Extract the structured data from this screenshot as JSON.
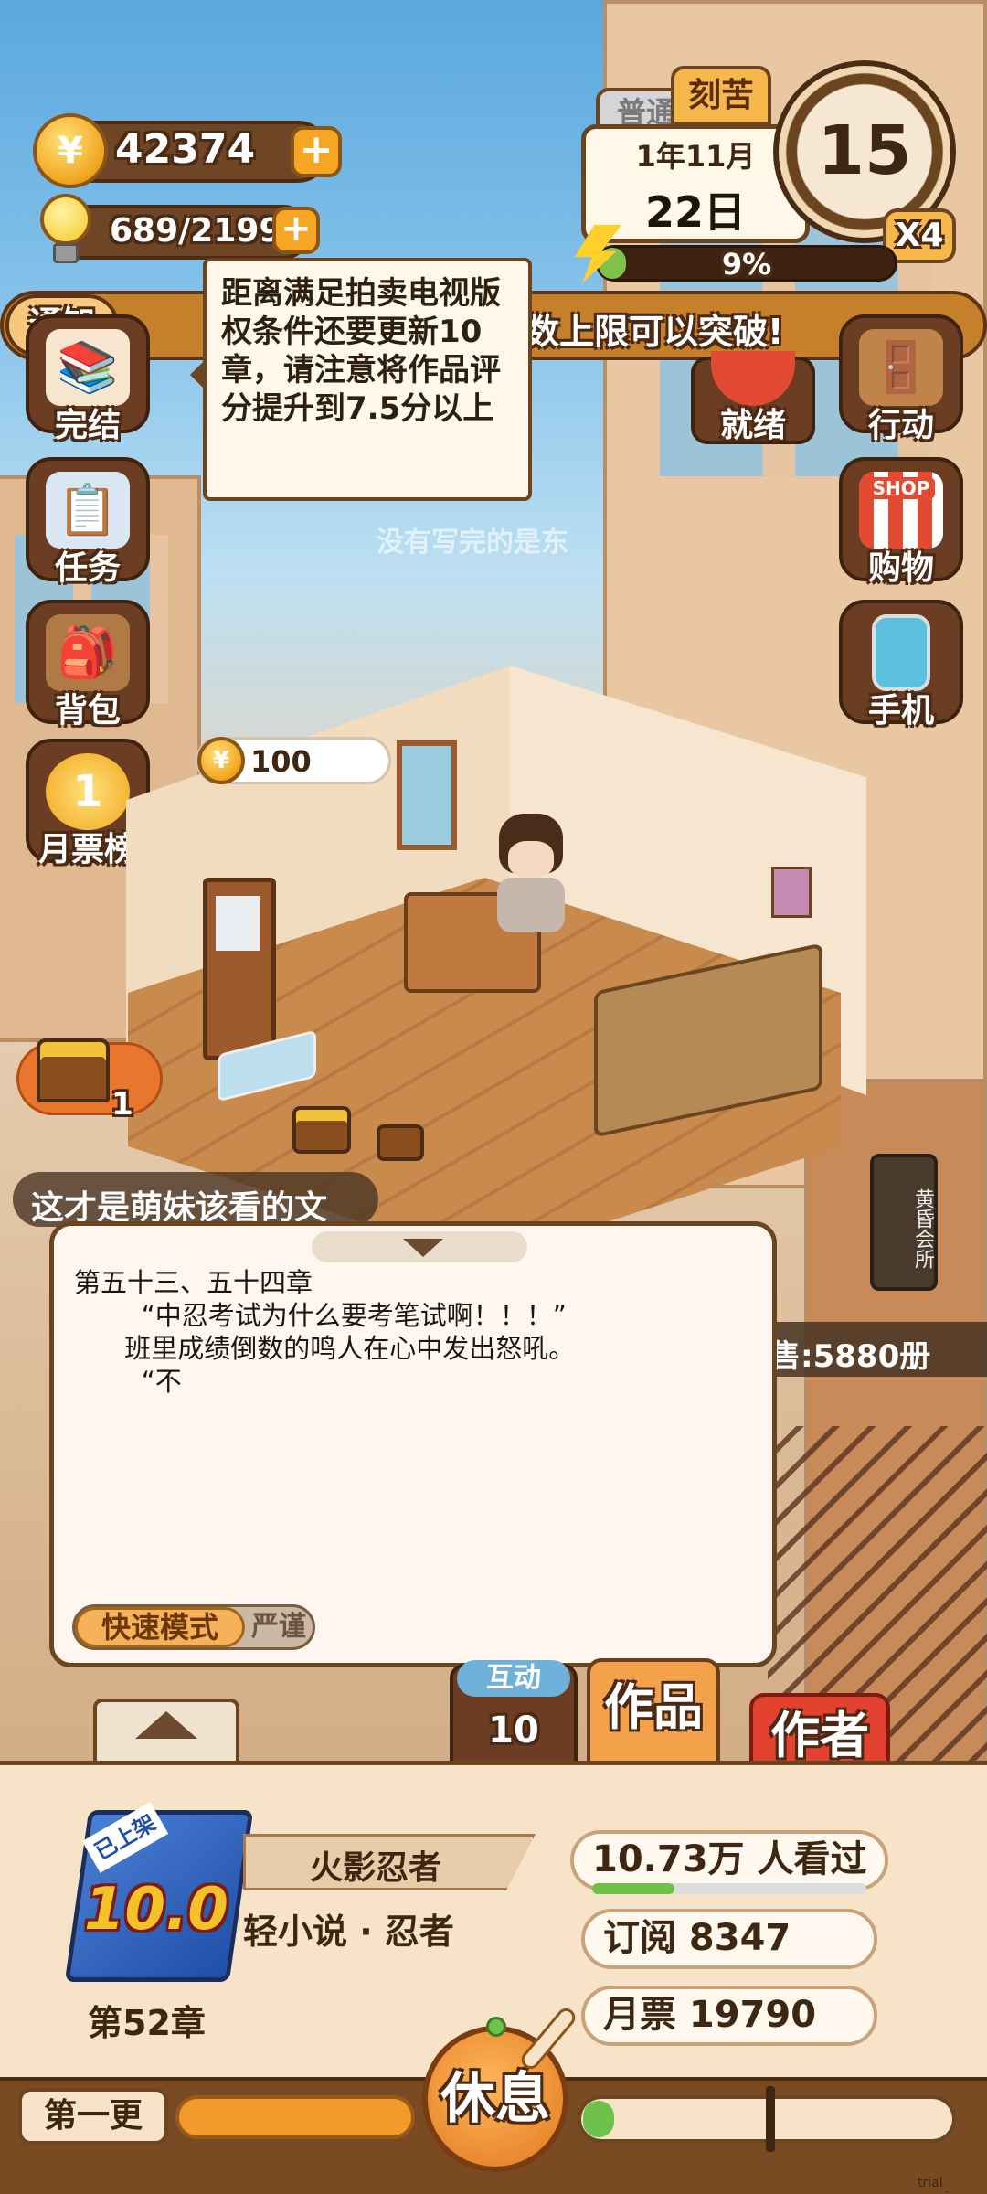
{
  "currency": {
    "coins": "42374",
    "energy": "689/2199",
    "coin_symbol": "¥"
  },
  "date_panel": {
    "mode_tab_normal": "普通",
    "mode_tab_hard": "刻苦",
    "year_month": "1年11月",
    "day": "22日",
    "progress_text": "9%",
    "progress_value": 0.09,
    "clock_number": "15",
    "speed": "X4"
  },
  "notice": {
    "label": "通知",
    "text": "数上限可以突破!"
  },
  "tooltip": {
    "text": "距离满足拍卖电视版权条件还要更新10章，请注意将作品评分提升到7.5分以上"
  },
  "left_menu": [
    {
      "label": "完结"
    },
    {
      "label": "任务"
    },
    {
      "label": "背包"
    },
    {
      "label": "月票榜"
    }
  ],
  "right_menu": [
    {
      "label": "就绪"
    },
    {
      "label": "行动"
    },
    {
      "label": "购物",
      "badge": "SHOP"
    },
    {
      "label": "手机"
    }
  ],
  "room": {
    "coin_bubble": "100",
    "chest_count": "1",
    "faded_caption": "没有写完的是东"
  },
  "comments": {
    "line1": "这才是萌妹该看的文",
    "sales_text": "售:5880册"
  },
  "sign": {
    "text": "黄昏会所"
  },
  "reader": {
    "chapter_title": "第五十三、五十四章",
    "line1": "        “中忍考试为什么要考笔试啊！！！”",
    "line2": "      班里成绩倒数的鸣人在心中发出怒吼。",
    "line3": "        “不",
    "mode_fast": "快速模式",
    "mode_strict": "严谨"
  },
  "tabs": {
    "interact": "互动",
    "interact_count": "10",
    "works": "作品",
    "author": "作者"
  },
  "book": {
    "badge": "已上架",
    "score": "10.0",
    "chapter": "第52章",
    "title": "火影忍者",
    "genre": "轻小说 · 忍者",
    "views": "10.73万 人看过",
    "subscribe": "订阅 8347",
    "monthly_votes": "月票 19790"
  },
  "footer": {
    "update_label": "第一更",
    "rest_button": "休息"
  },
  "watermark": "trial version"
}
